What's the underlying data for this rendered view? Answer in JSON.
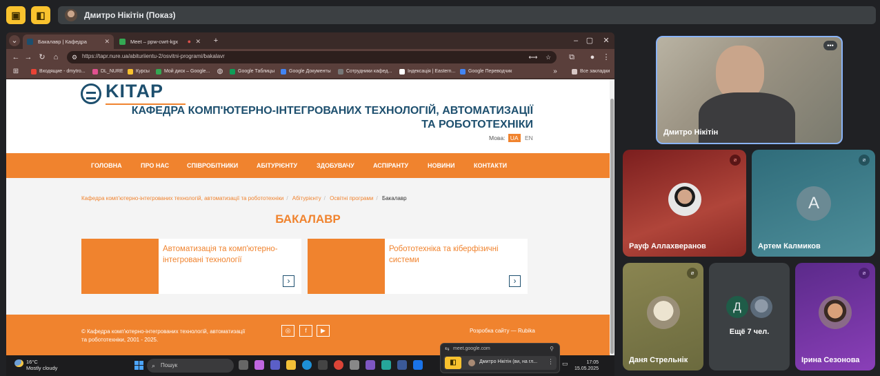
{
  "meet": {
    "presenter_label": "Дмитро Нікітін (Показ)",
    "top_icons": [
      "no-share-icon",
      "activities-icon"
    ]
  },
  "browser": {
    "tabs": [
      {
        "label": "Бакалавр | Кафедра комп'ютерно",
        "active": true
      },
      {
        "label": "Meet – ppw-cwrt-kgx",
        "active": false
      }
    ],
    "url": "https://tapr.nure.ua/abituriientu-2/osvitni-programi/bakalavr",
    "bookmarks": [
      "Входящие - dmytro...",
      "DL_NURE",
      "Курсы",
      "Мой диск – Google...",
      "Google Таблицы",
      "Google Документы",
      "Сотрудники кафед...",
      "Індексація | Eastern...",
      "Google Переводчик"
    ],
    "all_bookmarks": "Все закладки"
  },
  "site": {
    "logo_text": "KITAP",
    "dept_title": "КАФЕДРА КОМП'ЮТЕРНО-ІНТЕГРОВАНИХ ТЕХНОЛОГІЙ, АВТОМАТИЗАЦІЇ ТА РОБОТОТЕХНІКИ",
    "lang_label": "Мова:",
    "lang_ua": "UA",
    "lang_en": "EN",
    "nav": [
      "ГОЛОВНА",
      "ПРО НАС",
      "СПІВРОБІТНИКИ",
      "АБІТУРІЄНТУ",
      "ЗДОБУВАЧУ",
      "АСПІРАНТУ",
      "НОВИНИ",
      "КОНТАКТИ"
    ],
    "breadcrumbs": [
      "Кафедра комп'ютерно-інтегрованих технологій, автоматизації та робототехніки",
      "Абітурієнту",
      "Освітні програми"
    ],
    "breadcrumb_current": "Бакалавр",
    "heading": "БАКАЛАВР",
    "cards": [
      {
        "title": "Автоматизація та комп'ютерно-інтегровані технології"
      },
      {
        "title": "Робототехніка та кіберфізичні системи"
      }
    ],
    "footer_copy": "© Кафедра комп'ютерно-інтегрованих технологій, автоматизації та робототехніки, 2001 - 2025.",
    "footer_dev": "Розробка сайту — Rubika"
  },
  "taskbar": {
    "weather_temp": "16°C",
    "weather_desc": "Mostly cloudy",
    "search_placeholder": "Пошук",
    "time": "17:05",
    "date": "15.05.2025"
  },
  "share_popup": {
    "url": "meet.google.com",
    "label": "Дмитро Нікітін (ви, на гл..."
  },
  "participants": [
    {
      "name": "Дмитро Нікітін",
      "muted": false
    },
    {
      "name": "Рауф Аллахверанов",
      "muted": true
    },
    {
      "name": "Артем Калмиков",
      "muted": true,
      "initial": "А"
    },
    {
      "name": "Даня Стрельнік",
      "muted": true
    },
    {
      "name": "Ірина Сезонова",
      "muted": true
    }
  ],
  "more_participants": {
    "label": "Ещё 7 чел.",
    "initial": "Д"
  },
  "colors": {
    "accent_orange": "#f0832e",
    "brand_blue": "#1d4f6e",
    "meet_yellow": "#f9c22e"
  }
}
